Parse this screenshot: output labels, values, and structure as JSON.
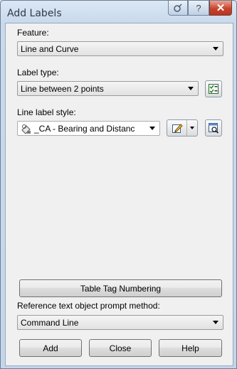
{
  "window": {
    "title": "Add Labels"
  },
  "feature": {
    "label": "Feature:",
    "value": "Line and Curve"
  },
  "label_type": {
    "label": "Label type:",
    "value": "Line between 2 points"
  },
  "line_label_style": {
    "label": "Line label style:",
    "value": "_CA - Bearing and Distanc"
  },
  "table_tag_button": "Table Tag Numbering",
  "reference_prompt": {
    "label": "Reference text object prompt method:",
    "value": "Command Line"
  },
  "buttons": {
    "add": "Add",
    "close": "Close",
    "help": "Help"
  },
  "icons": [
    "pin-icon",
    "help-icon",
    "close-icon",
    "label-type-check-icon",
    "style-tag-icon",
    "edit-style-icon",
    "pick-style-icon"
  ]
}
